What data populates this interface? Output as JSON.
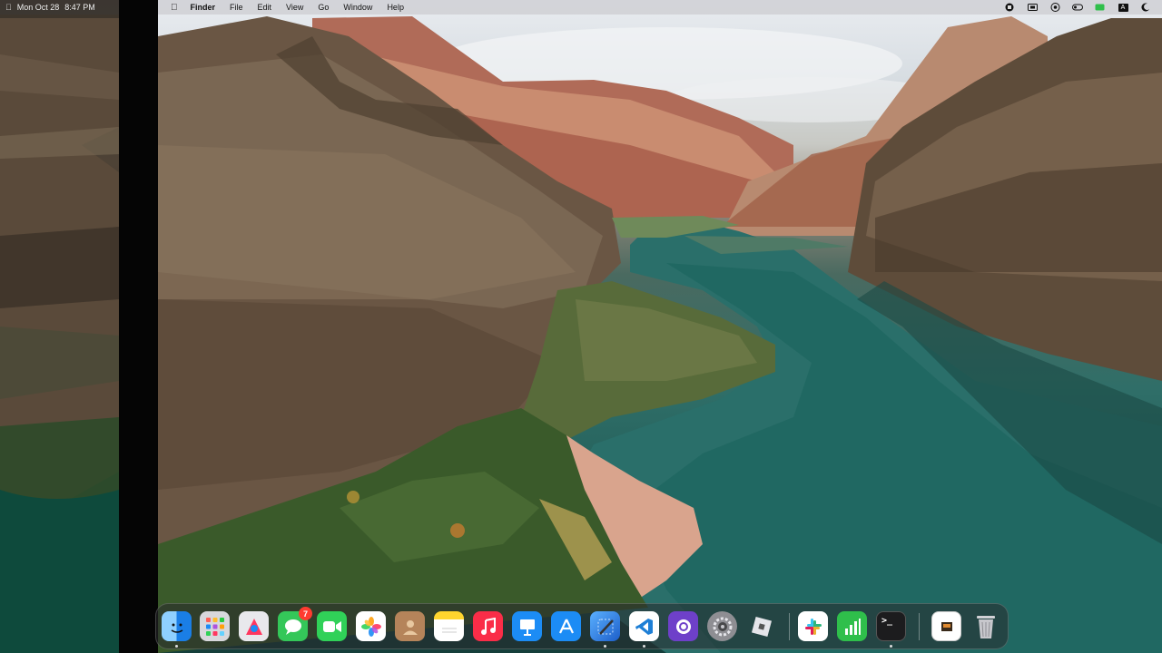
{
  "left_menubar": {
    "date": "Mon Oct 28",
    "time": "8:47 PM"
  },
  "menubar": {
    "app_name": "Finder",
    "menus": [
      "File",
      "Edit",
      "View",
      "Go",
      "Window",
      "Help"
    ],
    "status_icons": [
      "record-icon",
      "display-icon",
      "screen-mirroring-icon",
      "control-center-icon",
      "battery-icon",
      "input-source-icon",
      "focus-moon-icon"
    ],
    "input_source_label": "A"
  },
  "dock": {
    "apps": [
      {
        "name": "Finder",
        "icon": "finder-icon",
        "running": true
      },
      {
        "name": "Launchpad",
        "icon": "launchpad-icon",
        "running": false
      },
      {
        "name": "Xcode Preview",
        "icon": "design-app-icon",
        "running": false
      },
      {
        "name": "Messages",
        "icon": "messages-icon",
        "running": false,
        "badge": "7"
      },
      {
        "name": "FaceTime",
        "icon": "facetime-icon",
        "running": false
      },
      {
        "name": "Photos",
        "icon": "photos-icon",
        "running": false
      },
      {
        "name": "Contacts",
        "icon": "contacts-icon",
        "running": false
      },
      {
        "name": "Notes",
        "icon": "notes-icon",
        "running": false
      },
      {
        "name": "Music",
        "icon": "music-icon",
        "running": false
      },
      {
        "name": "Keynote",
        "icon": "keynote-icon",
        "running": false
      },
      {
        "name": "App Store",
        "icon": "app-store-icon",
        "running": false
      },
      {
        "name": "Xcode",
        "icon": "xcode-icon",
        "running": true
      },
      {
        "name": "Visual Studio Code",
        "icon": "vscode-icon",
        "running": true
      },
      {
        "name": "GitHub Desktop",
        "icon": "github-icon",
        "running": false
      },
      {
        "name": "System Settings",
        "icon": "settings-gear-icon",
        "running": false
      },
      {
        "name": "Roblox",
        "icon": "roblox-icon",
        "running": false
      },
      {
        "name": "Slack",
        "icon": "slack-icon",
        "running": false
      },
      {
        "name": "Numbers",
        "icon": "numbers-icon",
        "running": false
      },
      {
        "name": "Terminal",
        "icon": "terminal-icon",
        "running": true
      },
      {
        "name": "Downloads",
        "icon": "downloads-stack-icon",
        "running": false
      },
      {
        "name": "Trash",
        "icon": "trash-icon",
        "running": false
      }
    ]
  },
  "colors": {
    "badge": "#ff3b30",
    "messages": "#34c759",
    "facetime": "#30d158",
    "music": "#fa2d48",
    "app_store": "#1c8cf5",
    "vscode": "#1e7fd6",
    "github": "#6e40c9",
    "numbers": "#2fbf4b"
  }
}
